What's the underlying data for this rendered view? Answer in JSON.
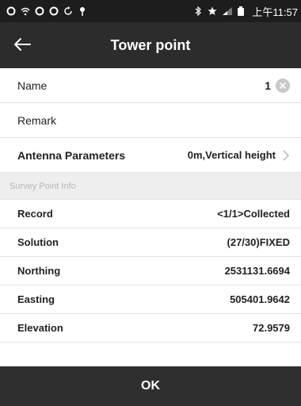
{
  "status_bar": {
    "icons": [
      "notification-icon",
      "wifi-icon",
      "notification-icon",
      "notification-icon",
      "sync-icon",
      "location-icon"
    ],
    "right_icons": [
      "bluetooth-icon",
      "star-icon",
      "signal-icon",
      "battery-icon"
    ],
    "time": "上午11:57"
  },
  "header": {
    "back_icon": "arrow-left-icon",
    "title": "Tower point"
  },
  "form": {
    "name": {
      "label": "Name",
      "value": "1"
    },
    "remark": {
      "label": "Remark",
      "value": ""
    },
    "antenna": {
      "label": "Antenna Parameters",
      "value": "0m,Vertical height"
    }
  },
  "section": {
    "title": "Survey Point Info"
  },
  "survey_info": [
    {
      "label": "Record",
      "value": "<1/1>Collected"
    },
    {
      "label": "Solution",
      "value": "(27/30)FIXED"
    },
    {
      "label": "Northing",
      "value": "2531131.6694"
    },
    {
      "label": "Easting",
      "value": "505401.9642"
    },
    {
      "label": "Elevation",
      "value": "72.9579"
    }
  ],
  "footer": {
    "ok_label": "OK"
  },
  "colors": {
    "status_bar": "#1d1d1d",
    "title_bar": "#2c2c2c",
    "ok_bar": "#2f2f2f",
    "section_header": "#eeeeee",
    "section_text": "#b7b7b7"
  }
}
